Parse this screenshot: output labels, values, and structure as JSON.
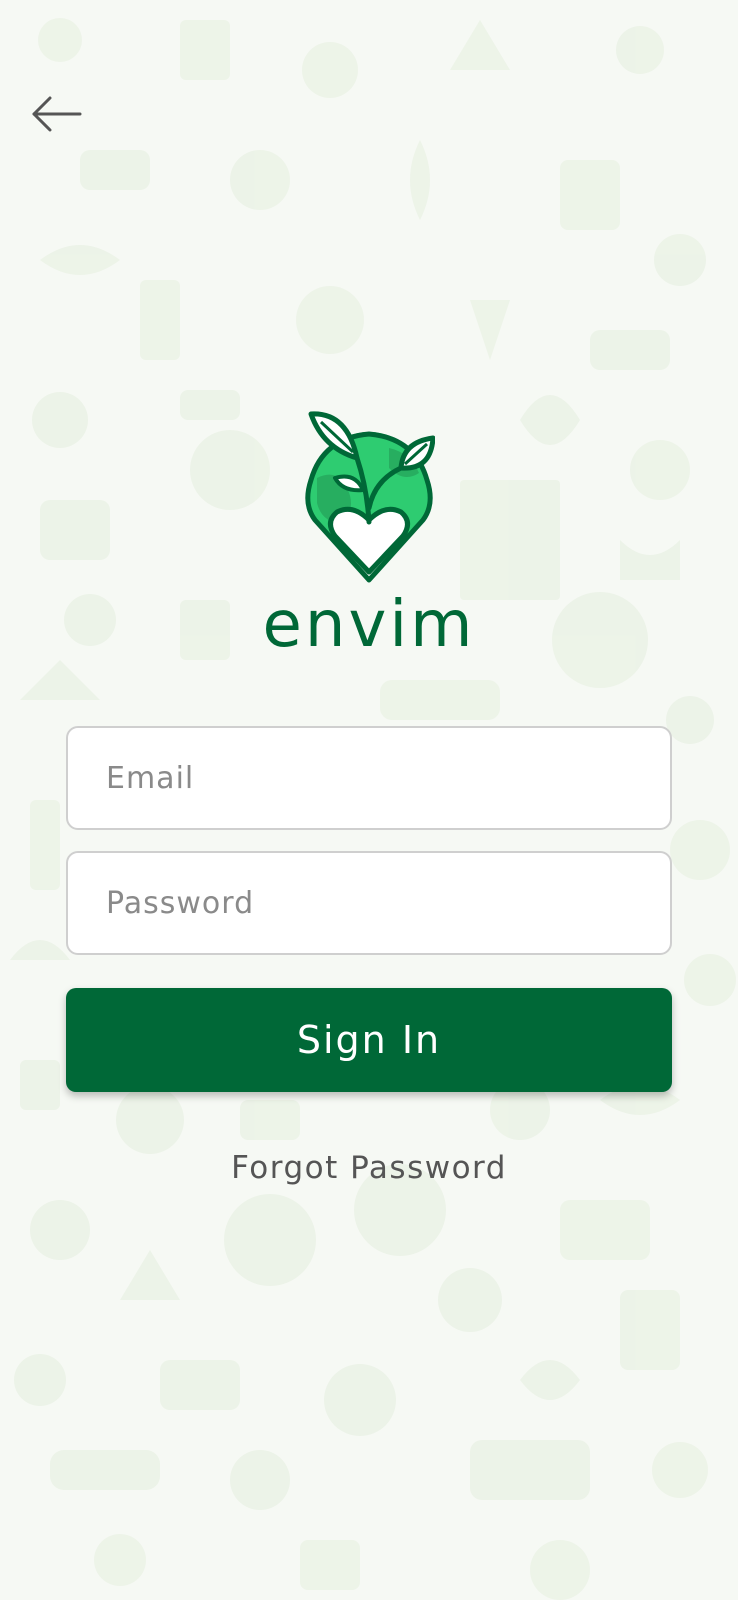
{
  "header": {
    "back_icon": "arrow-left-icon"
  },
  "brand": {
    "name": "envim",
    "logo_icon": "leaf-heart-globe-icon",
    "color": "#006837",
    "accent": "#2ecc71"
  },
  "form": {
    "email_placeholder": "Email",
    "password_placeholder": "Password",
    "signin_label": "Sign In",
    "forgot_label": "Forgot Password"
  },
  "background": {
    "pattern": "eco-icons-pattern",
    "color": "#f6f9f4"
  }
}
